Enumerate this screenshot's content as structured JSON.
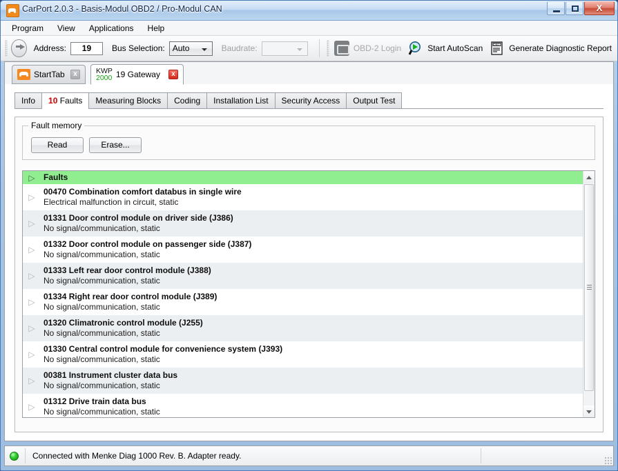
{
  "window": {
    "title": "CarPort 2.0.3  - Basis-Modul OBD2 / Pro-Modul CAN",
    "app_icon": "car-icon",
    "minimize_glyph": "",
    "maximize_glyph": "",
    "close_glyph": "X"
  },
  "menubar": {
    "items": [
      {
        "label": "Program"
      },
      {
        "label": "View"
      },
      {
        "label": "Applications"
      },
      {
        "label": "Help"
      }
    ]
  },
  "toolbar": {
    "go_icon": "arrow-right-circle-icon",
    "address_label": "Address:",
    "address_value": "19",
    "bus_label": "Bus Selection:",
    "bus_value": "Auto",
    "baudrate_label": "Baudrate:",
    "baudrate_value": "",
    "buttons": [
      {
        "label": "OBD-2 Login",
        "icon": "engine-icon",
        "enabled": false
      },
      {
        "label": "Start AutoScan",
        "icon": "magnifier-play-icon",
        "enabled": true
      },
      {
        "label": "Generate Diagnostic Report",
        "icon": "obd-report-icon",
        "enabled": true
      }
    ]
  },
  "doctabs": [
    {
      "label": "StartTab",
      "icon": "car-icon",
      "active": false,
      "close": "x"
    },
    {
      "label": "19 Gateway",
      "proto_line1": "KWP",
      "proto_line2": "2000",
      "active": true,
      "close": "x"
    }
  ],
  "functabs": [
    {
      "label": "Info",
      "count": "",
      "active": false
    },
    {
      "label": "Faults",
      "count": "10",
      "active": true
    },
    {
      "label": "Measuring Blocks",
      "count": "",
      "active": false
    },
    {
      "label": "Coding",
      "count": "",
      "active": false
    },
    {
      "label": "Installation List",
      "count": "",
      "active": false
    },
    {
      "label": "Security Access",
      "count": "",
      "active": false
    },
    {
      "label": "Output Test",
      "count": "",
      "active": false
    }
  ],
  "fault_memory": {
    "legend": "Fault memory",
    "read_label": "Read",
    "erase_label": "Erase..."
  },
  "fault_list": {
    "header": "Faults",
    "expander_glyph": "▷",
    "rows": [
      {
        "title": "00470 Combination comfort databus in single wire",
        "sub": "Electrical malfunction in circuit, static"
      },
      {
        "title": "01331 Door control module on driver side (J386)",
        "sub": "No signal/communication, static"
      },
      {
        "title": "01332 Door control module on passenger side (J387)",
        "sub": "No signal/communication, static"
      },
      {
        "title": "01333 Left rear door control module (J388)",
        "sub": "No signal/communication, static"
      },
      {
        "title": "01334 Right rear door control module (J389)",
        "sub": "No signal/communication, static"
      },
      {
        "title": "01320 Climatronic control module (J255)",
        "sub": "No signal/communication, static"
      },
      {
        "title": "01330 Central control module for convenience system (J393)",
        "sub": "No signal/communication, static"
      },
      {
        "title": "00381 Instrument cluster data bus",
        "sub": "No signal/communication, static"
      },
      {
        "title": "01312 Drive train data bus",
        "sub": "No signal/communication, static"
      }
    ]
  },
  "statusbar": {
    "led": "green",
    "text": "Connected with Menke Diag 1000 Rev. B. Adapter ready."
  },
  "colors": {
    "accent_orange": "#f5881f",
    "fault_count_red": "#d30000",
    "header_green": "#90ee90",
    "proto_green": "#16a016",
    "led_green": "#35d135"
  }
}
